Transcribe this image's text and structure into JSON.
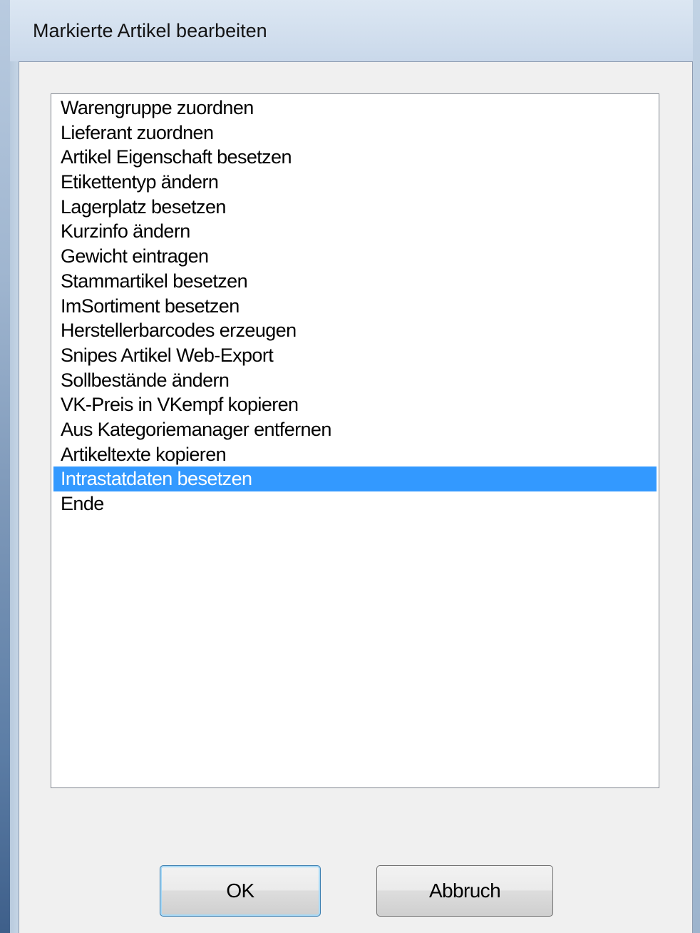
{
  "window": {
    "title": "Markierte Artikel bearbeiten"
  },
  "list": {
    "items": [
      "Warengruppe zuordnen",
      "Lieferant zuordnen",
      "Artikel Eigenschaft besetzen",
      "Etikettentyp ändern",
      "Lagerplatz besetzen",
      "Kurzinfo ändern",
      "Gewicht eintragen",
      "Stammartikel besetzen",
      "ImSortiment besetzen",
      "Herstellerbarcodes erzeugen",
      "Snipes Artikel Web-Export",
      "Sollbestände ändern",
      "VK-Preis in VKempf kopieren",
      "Aus Kategoriemanager entfernen",
      "Artikeltexte kopieren",
      "Intrastatdaten besetzen",
      "Ende"
    ],
    "selected_item": "Intrastatdaten besetzen"
  },
  "buttons": {
    "ok_label": "OK",
    "cancel_label": "Abbruch"
  },
  "colors": {
    "selection": "#3399ff",
    "dialog_background": "#f0f0f0",
    "list_background": "#ffffff"
  }
}
